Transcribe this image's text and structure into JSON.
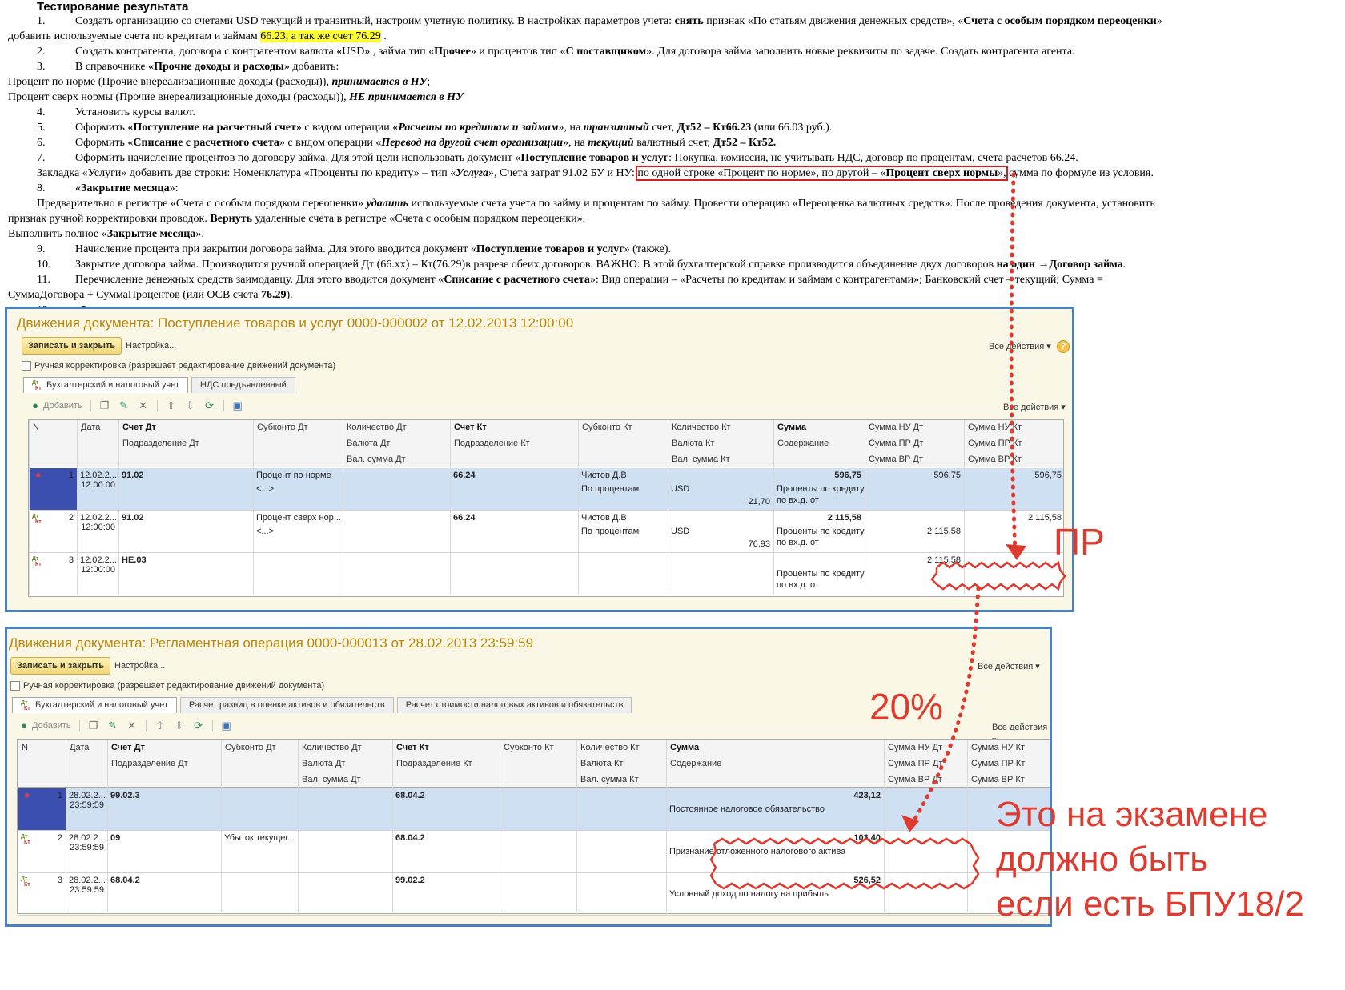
{
  "doc": {
    "title": "Тестирование результата",
    "lines": [
      {
        "num": "1.",
        "html": "Создать организацию со счетами USD текущий и транзитный, настроим учетную политику. В настройках параметров учета: <b>снять</b> признак «По статьям движения денежных средств»,  «<b>Счета с особым порядком переоценки</b>»",
        "ind": true
      },
      {
        "html": "добавить используемые счета по кредитам и займам <span class=\"hl\">66.23, а так же счет 76.29</span> ."
      },
      {
        "num": "2.",
        "html": "Создать контрагента, договора с контрагентом валюта «USD» , займа тип «<b>Прочее</b>» и процентов тип «<b>С поставщиком</b>». Для договора займа заполнить  новые реквизиты по задаче. Создать контрагента агента.",
        "ind": true
      },
      {
        "num": "3.",
        "html": "В справочнике «<b>Прочие доходы и расходы</b>» добавить:",
        "ind": true
      },
      {
        "html": "Процент по норме (Прочие внереализационные доходы (расходы)), <b><i>принимается в НУ</i></b>;"
      },
      {
        "html": "Процент сверх нормы (Прочие внереализационные доходы (расходы)), <b><i>НЕ принимается в НУ</i></b>"
      },
      {
        "num": "4.",
        "html": "Установить курсы валют.",
        "ind": true
      },
      {
        "num": "5.",
        "html": "Оформить «<b>Поступление на расчетный счет</b>» с видом операции «<b><i>Расчеты по кредитам и займам</i></b>», на <b><i>транзитный</i></b> счет,  <b>Дт52 – Кт66.23</b> (или 66.03 руб.).",
        "ind": true
      },
      {
        "num": "6.",
        "html": "Оформить «<b>Списание с расчетного счета</b>» с видом операции «<b><i>Перевод на другой счет организации</i></b>», на <b><i>текущий</i></b> валютный счет, <b>Дт52 – Кт52.</b>",
        "ind": true
      },
      {
        "num": "7.",
        "html": "Оформить начисление процентов по договору займа. Для этой цели использовать документ «<b>Поступление товаров и услуг</b>: Покупка, комиссия, не учитывать НДС, договор по процентам, счета расчетов 66.24.",
        "ind": true
      },
      {
        "html": "Закладка «Услуги» добавить две строки: Номенклатура «Проценты по кредиту» – тип «<b><i>Услуга</i></b>», Счета затрат 91.02 БУ и НУ: <span class=\"boxed\">по одной строке «Процент по норме», по другой – «<b>Процент сверх нормы</b>»,</span> сумма по формуле из условия.",
        "ind": true
      },
      {
        "num": "8.",
        "html": "«<b>Закрытие месяца</b>»:",
        "ind": true
      },
      {
        "html": "Предварительно в регистре «Счета с особым порядком переоценки» <b><i>удалить</i></b> используемые счета учета по займу и процентам по займу. Провести операцию «Переоценка валютных средств». После проведения документа, установить",
        "ind": true
      },
      {
        "html": "признак ручной корректировки проводок. <b>Вернуть</b> удаленные счета в регистре «Счета с особым порядком переоценки»."
      },
      {
        "html": "Выполнить полное «<b>Закрытие месяца</b>»."
      },
      {
        "num": "9.",
        "html": "Начисление процента при закрытии договора займа. Для этого вводится документ «<b>Поступление товаров и услуг</b>» (также).",
        "ind": true
      },
      {
        "num": "10.",
        "html": "Закрытие договора займа. Производится ручной операцией Дт (66.хх) – Кт(76.29)в разрезе обеих договоров. ВАЖНО: В этой бухгалтерской справке производится объединение двух договоров <b>на один →Договор займа</b>.",
        "ind": true
      },
      {
        "num": "11.",
        "html": "Перечисление денежных средств заимодавцу. Для этого вводится документ «<b>Списание с расчетного счета</b>»: Вид операции – «Расчеты по кредитам и займам с контрагентами»; Банковский счет – текущий; Сумма =",
        "ind": true
      },
      {
        "html": "СуммаДоговора + СуммаПроцентов (или ОСВ счета <b>76.29</b>)."
      },
      {
        "num": "12.",
        "html": "«<b>Закрытие месяца</b>» также.",
        "ind": true
      }
    ]
  },
  "common": {
    "save_close": "Записать и закрыть",
    "settings": "Настройка...",
    "all_actions": "Все действия ▾",
    "help": "?",
    "manual_corr": "Ручная корректировка (разрешает редактирование движений документа)",
    "add": "Добавить",
    "dt": "Дт",
    "kt": "Кт"
  },
  "win1": {
    "title": "Движения документа: Поступление товаров и услуг 0000-000002 от 12.02.2013 12:00:00",
    "tabs": [
      "Бухгалтерский и налоговый учет",
      "НДС предъявленный"
    ],
    "headers": [
      [
        "N",
        "Дата",
        "Счет Дт",
        "Субконто Дт",
        "Количество Дт",
        "Счет Кт",
        "Субконто Кт",
        "Количество Кт",
        "Сумма",
        "Сумма НУ Дт",
        "Сумма НУ Кт"
      ],
      [
        "",
        "",
        "Подразделение Дт",
        "",
        "Валюта Дт",
        "Подразделение Кт",
        "",
        "Валюта Кт",
        "Содержание",
        "Сумма ПР Дт",
        "Сумма ПР Кт"
      ],
      [
        "",
        "",
        "",
        "",
        "Вал. сумма Дт",
        "",
        "",
        "Вал. сумма Кт",
        "",
        "Сумма ВР Дт",
        "Сумма ВР Кт"
      ]
    ],
    "rows": [
      {
        "n": "1",
        "date": "12.02.2...",
        "time": "12:00:00",
        "acc_dt": "91.02",
        "sub_dt": "Процент по норме",
        "sub_dt2": "<...>",
        "acc_kt": "66.24",
        "sub_kt": "Чистов Д.В",
        "sub_kt2": "По процентам",
        "cur_kt": "USD",
        "val_kt": "21,70",
        "sum": "596,75",
        "content": "Проценты по кредиту",
        "content2": "по вх.д.  от",
        "nu_dt": "596,75",
        "pr_dt": "",
        "nu_kt": "596,75"
      },
      {
        "n": "2",
        "date": "12.02.2...",
        "time": "12:00:00",
        "acc_dt": "91.02",
        "sub_dt": "Процент сверх нор...",
        "sub_dt2": "<...>",
        "acc_kt": "66.24",
        "sub_kt": "Чистов Д.В",
        "sub_kt2": "По процентам",
        "cur_kt": "USD",
        "val_kt": "76,93",
        "sum": "2 115,58",
        "content": "Проценты по кредиту",
        "content2": "по вх.д.  от",
        "nu_dt": "",
        "pr_dt": "2 115,58",
        "nu_kt": "2 115,58"
      },
      {
        "n": "3",
        "date": "12.02.2...",
        "time": "12:00:00",
        "acc_dt": "НЕ.03",
        "sub_dt": "",
        "sub_dt2": "",
        "acc_kt": "",
        "sub_kt": "",
        "sub_kt2": "",
        "cur_kt": "",
        "val_kt": "",
        "sum": "",
        "content": "Проценты по кредиту",
        "content2": "по вх.д.  от",
        "nu_dt": "2 115,58",
        "pr_dt": "",
        "nu_kt": ""
      }
    ]
  },
  "win2": {
    "title": "Движения документа: Регламентная операция 0000-000013 от 28.02.2013 23:59:59",
    "tabs": [
      "Бухгалтерский и налоговый учет",
      "Расчет разниц в оценке активов и обязательств",
      "Расчет стоимости налоговых активов и обязательств"
    ],
    "headers": [
      [
        "N",
        "Дата",
        "Счет Дт",
        "Субконто Дт",
        "Количество Дт",
        "Счет Кт",
        "Субконто Кт",
        "Количество Кт",
        "Сумма",
        "Сумма НУ Дт",
        "Сумма НУ Кт"
      ],
      [
        "",
        "",
        "Подразделение Дт",
        "",
        "Валюта Дт",
        "Подразделение Кт",
        "",
        "Валюта Кт",
        "Содержание",
        "Сумма ПР Дт",
        "Сумма ПР Кт"
      ],
      [
        "",
        "",
        "",
        "",
        "Вал. сумма Дт",
        "",
        "",
        "Вал. сумма Кт",
        "",
        "Сумма ВР Дт",
        "Сумма ВР Кт"
      ]
    ],
    "rows": [
      {
        "n": "1",
        "date": "28.02.2...",
        "time": "23:59:59",
        "acc_dt": "99.02.3",
        "sub_dt": "",
        "acc_kt": "68.04.2",
        "sum": "423,12",
        "content": "Постоянное налоговое обязательство"
      },
      {
        "n": "2",
        "date": "28.02.2...",
        "time": "23:59:59",
        "acc_dt": "09",
        "sub_dt": "Убыток текущег...",
        "acc_kt": "68.04.2",
        "sum": "103,40",
        "content": "Признание отложенного налогового актива"
      },
      {
        "n": "3",
        "date": "28.02.2...",
        "time": "23:59:59",
        "acc_dt": "68.04.2",
        "sub_dt": "",
        "acc_kt": "99.02.2",
        "sum": "526,52",
        "content": "Условный доход по налогу на прибыль"
      }
    ]
  },
  "annotations": {
    "pr": "ПР",
    "pct": "20%",
    "exam_line1": "Это на экзамене",
    "exam_line2": "должно быть",
    "exam_line3": "если есть БПУ18/2"
  },
  "colors": {
    "annotation": "#e03a2f",
    "window_border": "#4a7fc1",
    "title": "#b8860b",
    "highlight": "#ffff33",
    "selection": "#cfe0f3"
  }
}
